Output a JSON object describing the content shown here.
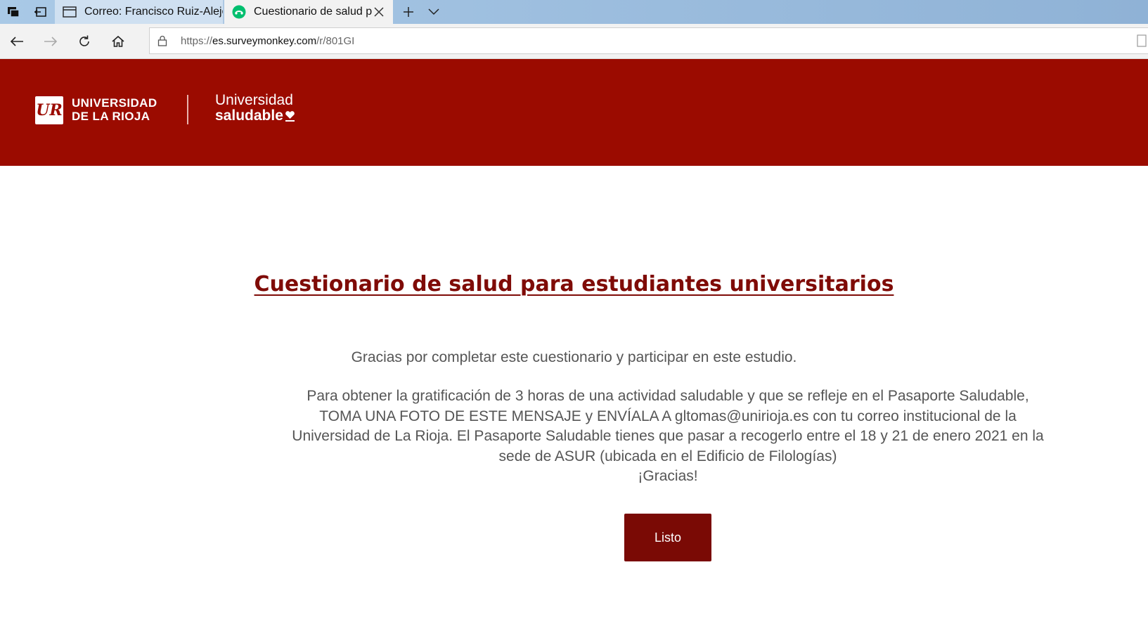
{
  "browser": {
    "tabs": [
      {
        "label": "Correo: Francisco Ruiz-Alejo",
        "icon": "window-icon"
      },
      {
        "label": "Cuestionario de salud para estudiantes",
        "icon": "surveymonkey-icon"
      }
    ],
    "address": {
      "prefix": "https://",
      "domain": "es.surveymonkey.com",
      "path": "/r/801GI"
    }
  },
  "header": {
    "uni_line1": "UNIVERSIDAD",
    "uni_line2": "DE LA RIOJA",
    "uni_logo_mark": "UR",
    "us_line1": "Universidad",
    "us_line2": "saludable",
    "band_color": "#9b0b00"
  },
  "content": {
    "title": "Cuestionario de salud para estudiantes universitarios",
    "thanks": "Gracias por completar este cuestionario y participar en este estudio.",
    "lines": [
      "Para obtener la gratificación de 3 horas de una actividad saludable y que se refleje en el Pasaporte Saludable,",
      "TOMA UNA FOTO DE ESTE MENSAJE y ENVÍALA A gltomas@unirioja.es con tu correo institucional de la",
      "Universidad de La Rioja. El Pasaporte Saludable tienes que pasar a recogerlo entre el 18 y 21 de enero 2021 en la",
      "sede de ASUR (ubicada en el Edificio de Filologías)",
      "¡Gracias!"
    ],
    "done_button": "Listo"
  }
}
